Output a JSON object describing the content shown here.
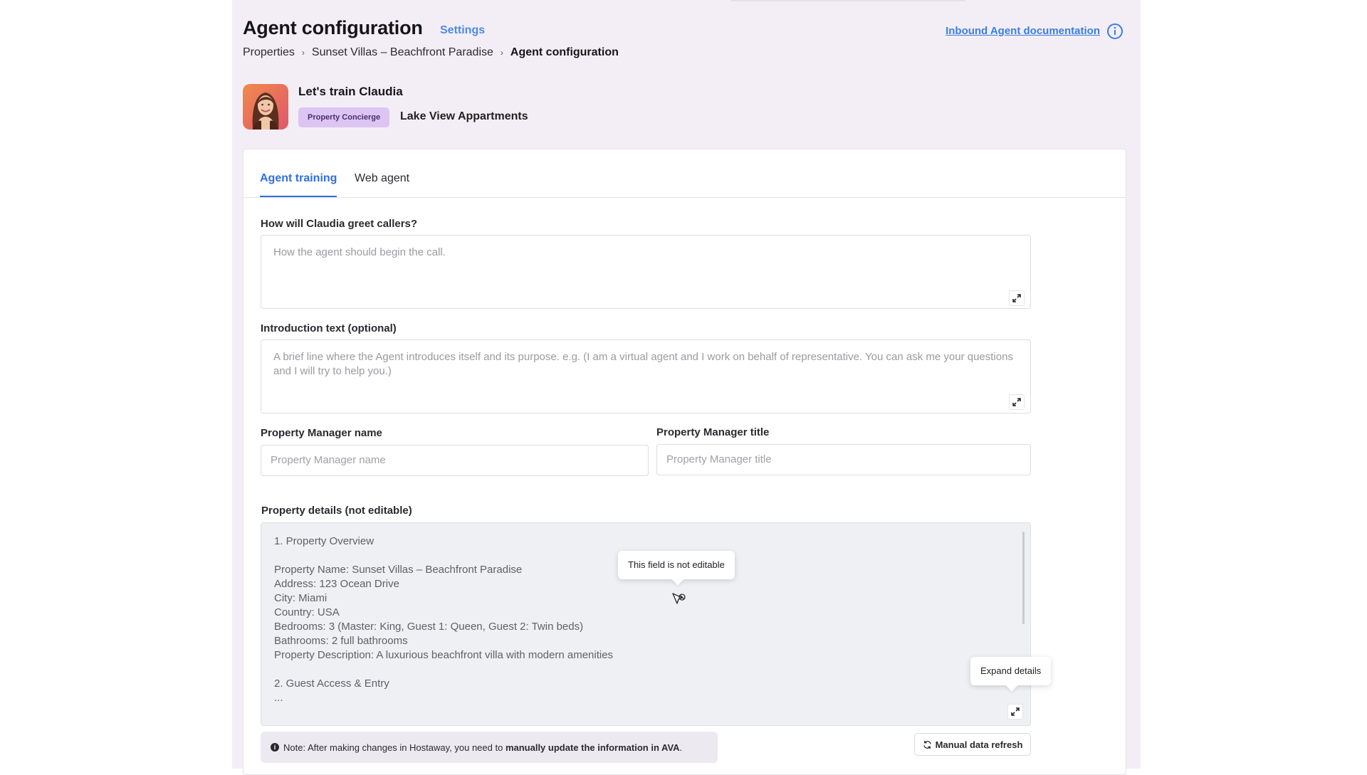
{
  "header": {
    "title": "Agent configuration",
    "settings_link": "Settings",
    "doc_link": "Inbound Agent documentation"
  },
  "breadcrumb": {
    "items": [
      "Properties",
      "Sunset Villas – Beachfront Paradise",
      "Agent configuration"
    ]
  },
  "agent": {
    "heading": "Let's train Claudia",
    "badge": "Property Concierge",
    "property": "Lake View Appartments"
  },
  "tabs": [
    "Agent training",
    "Web agent"
  ],
  "form": {
    "greeting": {
      "label": "How will Claudia greet callers?",
      "placeholder": "How the agent should begin the call."
    },
    "intro": {
      "label": "Introduction text (optional)",
      "placeholder": "A brief line where the Agent introduces itself and its purpose. e.g. (I am a virtual agent and I work on behalf of representative. You can ask me your questions and I will try to help you.)"
    },
    "pm_name": {
      "label": "Property Manager name",
      "placeholder": "Property Manager name"
    },
    "pm_title": {
      "label": "Property Manager title",
      "placeholder": "Property Manager title"
    },
    "details": {
      "label": "Property details (not editable)",
      "lines": [
        "1. Property Overview",
        "",
        "Property Name: Sunset Villas – Beachfront Paradise",
        "Address: 123 Ocean Drive",
        "City: Miami",
        "Country: USA",
        "Bedrooms: 3 (Master: King, Guest 1: Queen, Guest 2: Twin beds)",
        "Bathrooms: 2 full bathrooms",
        "Property Description: A luxurious beachfront villa with modern amenities",
        "",
        "2. Guest Access & Entry",
        "..."
      ]
    }
  },
  "tooltips": {
    "not_editable": "This field is not editable",
    "expand": "Expand details"
  },
  "note": {
    "prefix": "Note: After making changes in Hostaway, you need to ",
    "bold": "manually update the information in AVA",
    "suffix": "."
  },
  "refresh_button": "Manual data refresh",
  "colors": {
    "accent": "#2f6fe0",
    "link": "#3b7ee0",
    "badge_bg": "#dcc5f2",
    "page_bg": "#f3eef6"
  },
  "icons": [
    "info-icon",
    "expand-icon",
    "refresh-icon",
    "cursor-icon",
    "breadcrumb-chevron-icon"
  ]
}
